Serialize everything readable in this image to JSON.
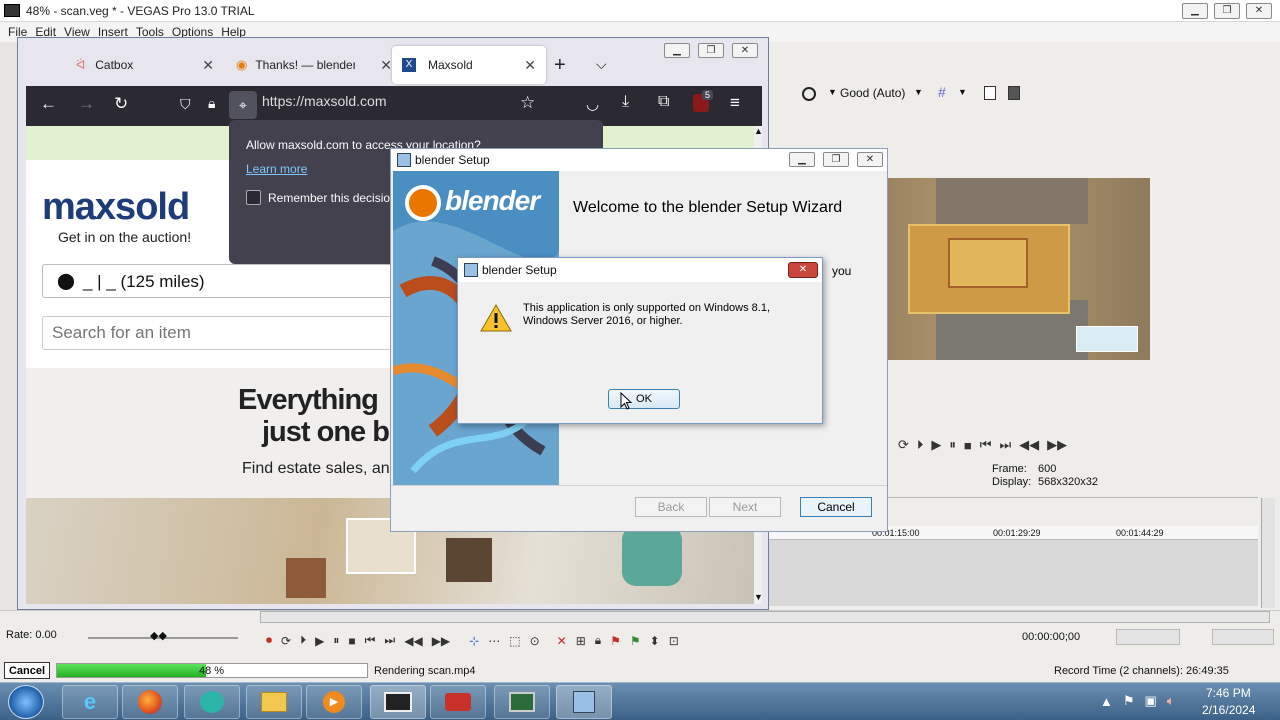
{
  "vegas": {
    "title": "48% - scan.veg * - VEGAS Pro 13.0 TRIAL",
    "menu": [
      "File",
      "Edit",
      "View",
      "Insert",
      "Tools",
      "Options",
      "Help"
    ],
    "preview_quality": "Good (Auto)",
    "frame_label": "Frame:",
    "frame_value": "600",
    "display_label": "Display:",
    "display_value": "568x320x32",
    "timecodes": [
      "00:01:15:00",
      "00:01:29:29",
      "00:01:44:29"
    ],
    "rate": "Rate: 0.00",
    "time": "00:00:00;00",
    "cancel_label": "Cancel",
    "progress_text": "48 %",
    "progress": 0.48,
    "rendering": "Rendering scan.mp4",
    "record_time": "Record Time (2 channels): 26:49:35"
  },
  "firefox": {
    "tabs": [
      {
        "label": "Catbox"
      },
      {
        "label": "Thanks! — blender"
      },
      {
        "label": "Maxsold"
      }
    ],
    "url": "https://maxsold.com",
    "extension_badge": "5",
    "location_prompt": {
      "message": "Allow maxsold.com to access your location?",
      "learn_more": "Learn more",
      "remember": "Remember this decision"
    },
    "page": {
      "logo": "maxsold",
      "tagline": "Get in on the auction!",
      "location_value": "_ | _ (125 miles)",
      "search_placeholder": "Search for an item",
      "headline_1": "Everything",
      "headline_2": "just one b",
      "subhead": "Find estate sales, and"
    }
  },
  "setup": {
    "title": "blender Setup",
    "welcome": "Welcome to the blender Setup Wizard",
    "partial_text": "you",
    "brand": "blender",
    "back": "Back",
    "next": "Next",
    "cancel": "Cancel"
  },
  "alert": {
    "title": "blender Setup",
    "message": "This application is only supported on Windows 8.1, Windows Server 2016, or higher.",
    "ok": "OK"
  },
  "taskbar": {
    "time": "7:46 PM",
    "date": "2/16/2024"
  }
}
